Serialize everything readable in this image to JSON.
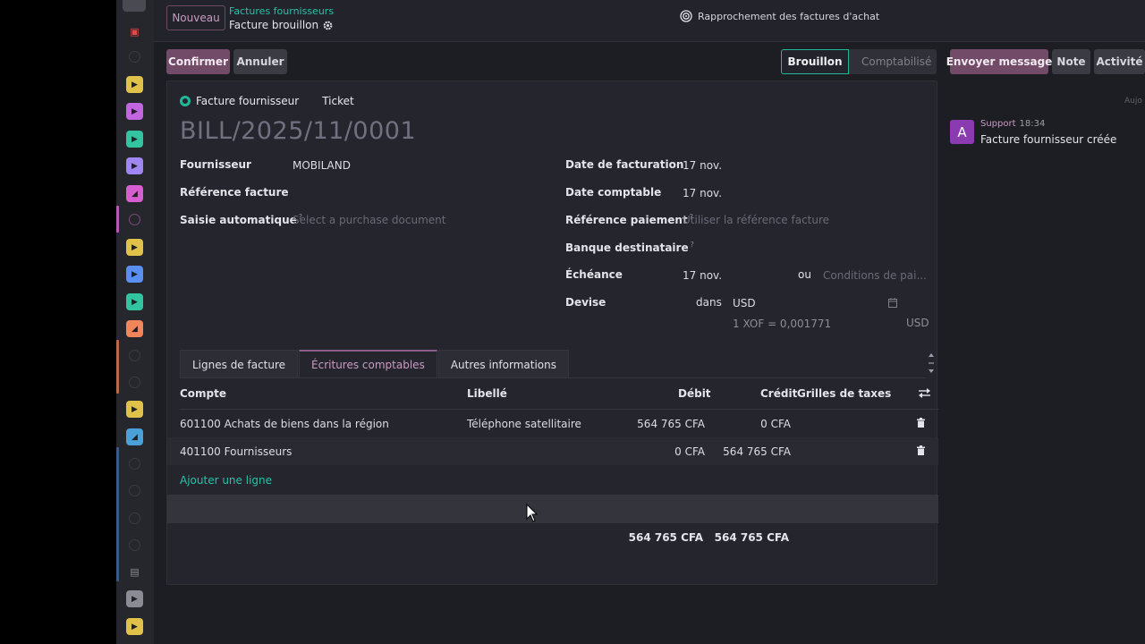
{
  "topbar": {
    "new_button": "Nouveau",
    "breadcrumb_parent": "Factures fournisseurs",
    "breadcrumb_current": "Facture brouillon",
    "rapprochement_label": "Rapprochement des factures d'achat"
  },
  "actions": {
    "confirm": "Confirmer",
    "cancel": "Annuler"
  },
  "status": {
    "current": "Brouillon",
    "next": "Comptabilisé"
  },
  "chatter_buttons": {
    "send_message": "Envoyer message",
    "note": "Note",
    "activity": "Activité"
  },
  "form": {
    "types": [
      "Facture fournisseur",
      "Ticket"
    ],
    "number": "BILL/2025/11/0001",
    "left": {
      "vendor_label": "Fournisseur",
      "vendor_value": "MOBILAND",
      "ref_label": "Référence facture",
      "auto_label": "Saisie automatique",
      "auto_help": "?",
      "auto_placeholder": "Select a purchase document"
    },
    "right": {
      "invoice_date_label": "Date de facturation",
      "invoice_date_value": "17 nov.",
      "accounting_date_label": "Date comptable",
      "accounting_date_value": "17 nov.",
      "payment_ref_label": "Référence paiement",
      "payment_ref_help": "?",
      "payment_ref_placeholder": "Utiliser la référence facture",
      "bank_label": "Banque destinataire",
      "bank_help": "?",
      "due_label": "Échéance",
      "due_value": "17 nov.",
      "due_or": "ou",
      "due_terms_placeholder": "Conditions de pai...",
      "currency_label": "Devise",
      "currency_in": "dans",
      "currency_value": "USD",
      "rate_text": "1 XOF = 0,001771",
      "rate_currency": "USD"
    }
  },
  "tabs": [
    "Lignes de facture",
    "Écritures comptables",
    "Autres informations"
  ],
  "table": {
    "headers": {
      "account": "Compte",
      "label": "Libellé",
      "debit": "Débit",
      "credit": "Crédit",
      "tax_grids": "Grilles de taxes"
    },
    "rows": [
      {
        "account": "601100 Achats de biens dans la région",
        "label": "Téléphone satellitaire",
        "debit": "564 765 CFA",
        "credit": "0 CFA"
      },
      {
        "account": "401100 Fournisseurs",
        "label": "",
        "debit": "0 CFA",
        "credit": "564 765 CFA"
      }
    ],
    "add_line": "Ajouter une ligne",
    "total_debit": "564 765 CFA",
    "total_credit": "564 765 CFA"
  },
  "chatter": {
    "date_separator": "Aujo",
    "author": "Support",
    "time": "18:34",
    "avatar_letter": "A",
    "message": "Facture fournisseur créée"
  },
  "colors": {
    "primary": "#714b67",
    "accent_green": "#27c2a9",
    "background": "#1d1e24"
  }
}
